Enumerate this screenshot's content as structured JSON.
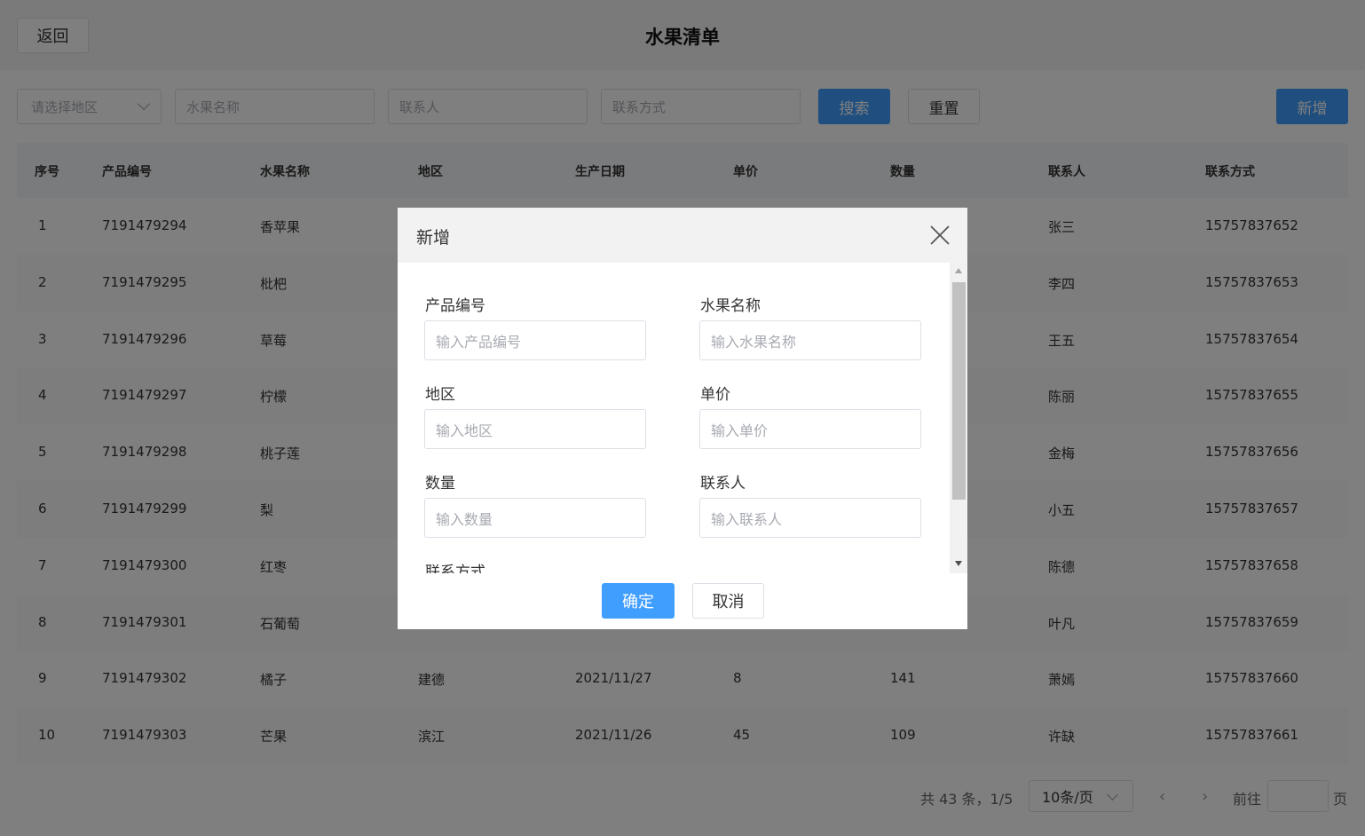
{
  "header": {
    "back_label": "返回",
    "title": "水果清单"
  },
  "filters": {
    "region_placeholder": "请选择地区",
    "fruit_name_placeholder": "水果名称",
    "contact_placeholder": "联系人",
    "phone_placeholder": "联系方式",
    "search_label": "搜索",
    "reset_label": "重置",
    "add_label": "新增"
  },
  "table": {
    "columns": [
      "序号",
      "产品编号",
      "水果名称",
      "地区",
      "生产日期",
      "单价",
      "数量",
      "联系人",
      "联系方式"
    ],
    "rows": [
      [
        "1",
        "7191479294",
        "香苹果",
        "",
        "",
        "",
        "",
        "张三",
        "15757837652"
      ],
      [
        "2",
        "7191479295",
        "枇杷",
        "",
        "",
        "",
        "",
        "李四",
        "15757837653"
      ],
      [
        "3",
        "7191479296",
        "草莓",
        "",
        "",
        "",
        "",
        "王五",
        "15757837654"
      ],
      [
        "4",
        "7191479297",
        "柠檬",
        "",
        "",
        "",
        "",
        "陈丽",
        "15757837655"
      ],
      [
        "5",
        "7191479298",
        "桃子莲",
        "",
        "",
        "",
        "",
        "金梅",
        "15757837656"
      ],
      [
        "6",
        "7191479299",
        "梨",
        "",
        "",
        "",
        "",
        "小五",
        "15757837657"
      ],
      [
        "7",
        "7191479300",
        "红枣",
        "",
        "",
        "",
        "",
        "陈德",
        "15757837658"
      ],
      [
        "8",
        "7191479301",
        "石葡萄",
        "",
        "",
        "",
        "",
        "叶凡",
        "15757837659"
      ],
      [
        "9",
        "7191479302",
        "橘子",
        "建德",
        "2021/11/27",
        "8",
        "141",
        "萧嫣",
        "15757837660"
      ],
      [
        "10",
        "7191479303",
        "芒果",
        "滨江",
        "2021/11/26",
        "45",
        "109",
        "许缺",
        "15757837661"
      ]
    ]
  },
  "pagination": {
    "total_text": "共 43 条，1/5",
    "page_size": "10条/页",
    "prev_icon": "‹",
    "next_icon": "›",
    "goto_label": "前往",
    "page_suffix": "页"
  },
  "dialog": {
    "title": "新增",
    "fields": [
      {
        "label": "产品编号",
        "placeholder": "输入产品编号"
      },
      {
        "label": "水果名称",
        "placeholder": "输入水果名称"
      },
      {
        "label": "地区",
        "placeholder": "输入地区"
      },
      {
        "label": "单价",
        "placeholder": "输入单价"
      },
      {
        "label": "数量",
        "placeholder": "输入数量"
      },
      {
        "label": "联系人",
        "placeholder": "输入联系人"
      },
      {
        "label": "联系方式",
        "placeholder": ""
      }
    ],
    "confirm_label": "确定",
    "cancel_label": "取消"
  },
  "colors": {
    "primary": "#409eff",
    "overlay": "rgba(0,0,0,0.5)"
  },
  "icons": [
    "chevron-down-icon",
    "close-icon",
    "chevron-left-icon",
    "chevron-right-icon"
  ]
}
